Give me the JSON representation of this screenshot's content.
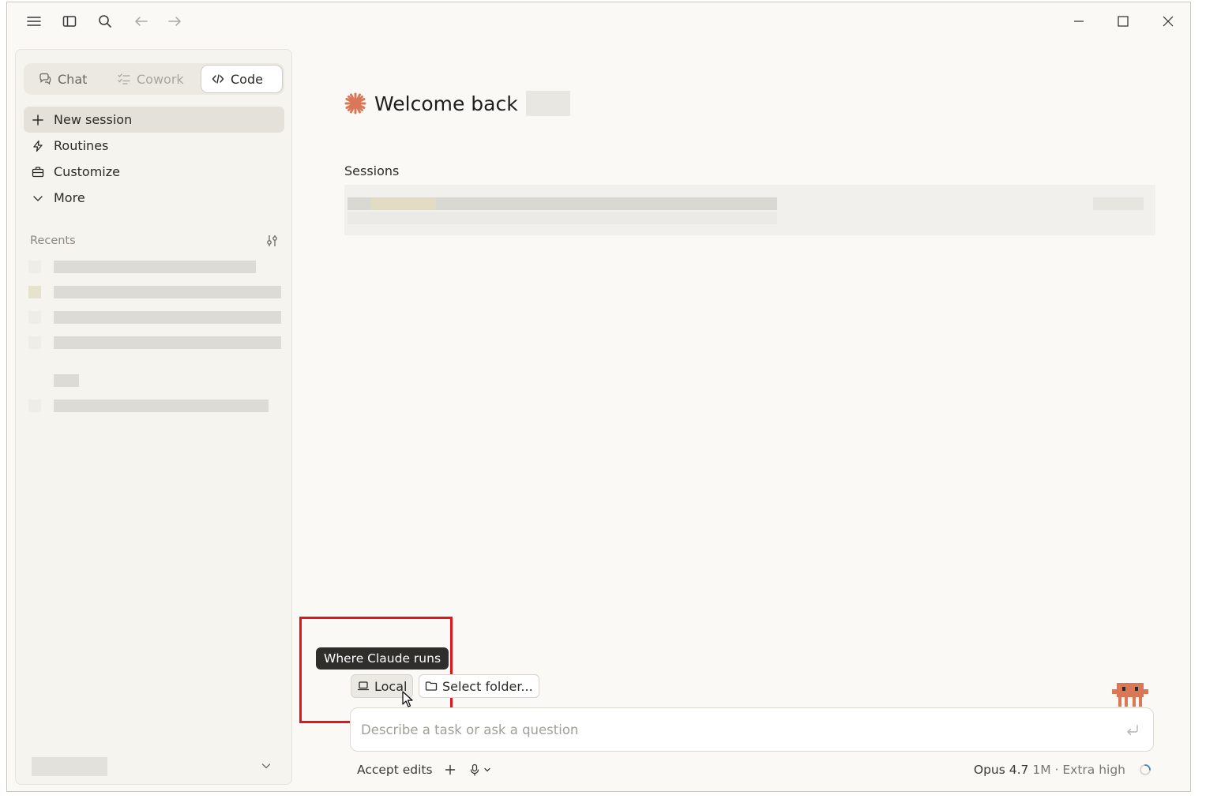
{
  "window": {
    "menu_icon": "hamburger-icon",
    "sidebar_toggle_icon": "sidebar-toggle-icon",
    "search_icon": "search-icon",
    "back_icon": "arrow-left-icon",
    "forward_icon": "arrow-right-icon",
    "minimize_icon": "minimize-icon",
    "maximize_icon": "maximize-icon",
    "close_icon": "close-icon"
  },
  "sidebar": {
    "modes": [
      {
        "label": "Chat",
        "icon": "chat-bubbles-icon",
        "state": "normal"
      },
      {
        "label": "Cowork",
        "icon": "checklist-icon",
        "state": "disabled"
      },
      {
        "label": "Code",
        "icon": "code-brackets-icon",
        "state": "active"
      }
    ],
    "nav": [
      {
        "label": "New session",
        "icon": "plus-icon",
        "selected": true
      },
      {
        "label": "Routines",
        "icon": "lightning-icon",
        "selected": false
      },
      {
        "label": "Customize",
        "icon": "briefcase-icon",
        "selected": false
      },
      {
        "label": "More",
        "icon": "chevron-down-icon",
        "selected": false
      }
    ],
    "recents": {
      "label": "Recents",
      "filter_icon": "sliders-icon"
    },
    "footer_chevron_icon": "chevron-down-icon"
  },
  "main": {
    "welcome": "Welcome back",
    "logo_icon": "claude-starburst-icon",
    "logo_color": "#d97757",
    "sessions_label": "Sessions",
    "tooltip": "Where Claude runs",
    "env_chip": {
      "label": "Local",
      "icon": "laptop-icon"
    },
    "folder_chip": {
      "label": "Select folder...",
      "icon": "folder-icon"
    },
    "composer": {
      "placeholder": "Describe a task or ask a question",
      "value": "",
      "send_icon": "enter-return-icon"
    },
    "bottom": {
      "accept_label": "Accept edits",
      "add_icon": "plus-icon",
      "mic_icon": "microphone-icon",
      "model": "Opus 4.7",
      "model_detail": "1M · Extra high",
      "status_icon": "spinner-icon"
    },
    "mascot_icon": "pixel-crab-mascot-icon",
    "highlight_color": "#e0161c"
  }
}
